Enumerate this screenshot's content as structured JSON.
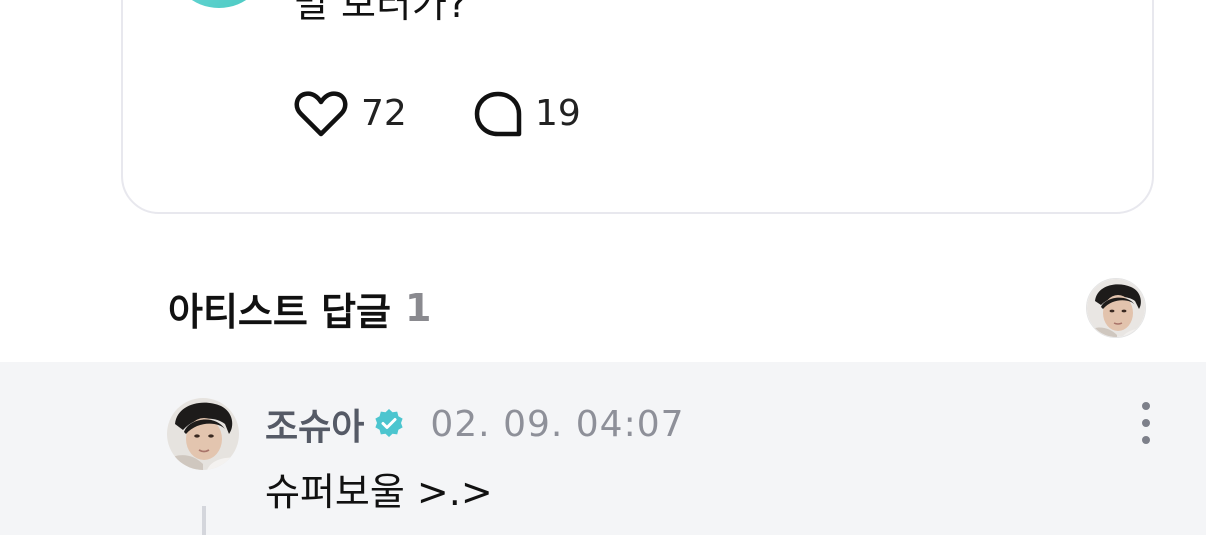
{
  "post": {
    "text": "멀 보러가?",
    "likes": "72",
    "comments": "19",
    "like_icon": "heart-outline-icon",
    "comment_icon": "speech-bubble-icon"
  },
  "artist_reply_section": {
    "title": "아티스트 답글",
    "count": "1"
  },
  "reply": {
    "author": "조슈아",
    "verified_icon": "verified-badge-icon",
    "timestamp": "02. 09. 04:07",
    "text": "슈퍼보울 >.>",
    "more_icon": "more-vertical-icon"
  },
  "colors": {
    "reply_background": "#f4f5f7",
    "verified_badge": "#4cc5cf",
    "muted_text": "#8e9099",
    "card_border": "#e8e8ee"
  }
}
